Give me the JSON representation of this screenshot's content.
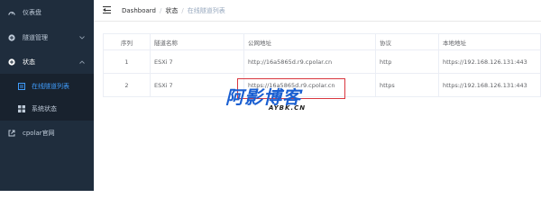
{
  "sidebar": {
    "items": [
      {
        "label": "仪表盘",
        "icon": "speedometer-icon"
      },
      {
        "label": "隧道管理",
        "icon": "plus-circle-icon",
        "chevron": "chevron-down-icon"
      },
      {
        "label": "状态",
        "icon": "plus-circle-icon",
        "chevron": "chevron-up-icon"
      },
      {
        "label": "在线隧道列表",
        "icon": "list-icon"
      },
      {
        "label": "系统状态",
        "icon": "grid-icon"
      },
      {
        "label": "cpolar官网",
        "icon": "external-link-icon"
      }
    ],
    "active_item": "在线隧道列表"
  },
  "breadcrumb": {
    "items": [
      "Dashboard",
      "状态",
      "在线隧道列表"
    ],
    "separator": "/"
  },
  "table": {
    "headers": [
      "序列",
      "隧道名称",
      "公网地址",
      "协议",
      "本地地址"
    ],
    "rows": [
      [
        "1",
        "ESXi 7",
        "http://16a5865d.r9.cpolar.cn",
        "http",
        "https://192.168.126.131:443"
      ],
      [
        "2",
        "ESXi 7",
        "https://16a5865d.r9.cpolar.cn",
        "https",
        "https://192.168.126.131:443"
      ]
    ]
  },
  "watermark": {
    "main": "阿影博客",
    "sub": "AYBK.CN"
  },
  "colors": {
    "sidebar_bg": "#1f2d3d",
    "submenu_bg": "#18222e",
    "active": "#409eff",
    "highlight_border": "#d9363e",
    "watermark": "#1a5fd1"
  }
}
